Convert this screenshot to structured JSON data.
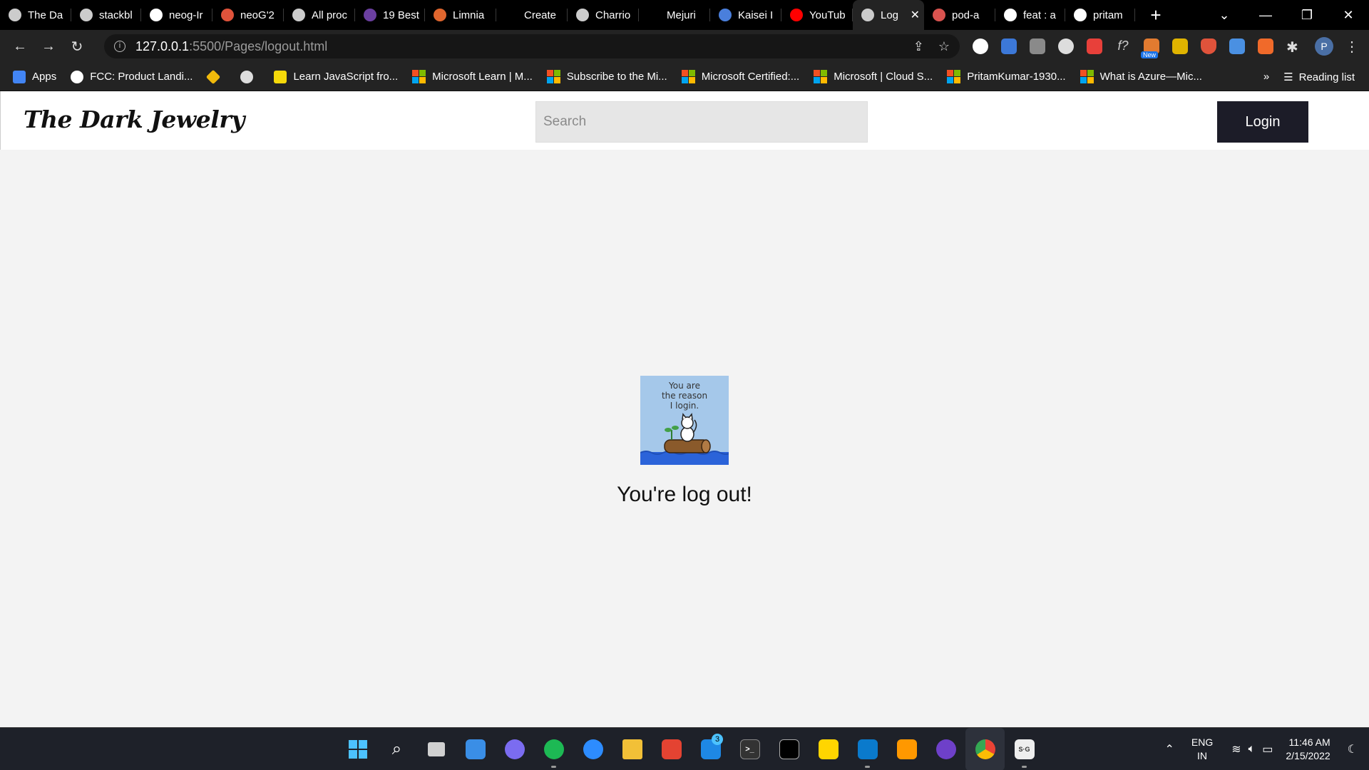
{
  "browser": {
    "tabs": [
      {
        "label": "The Da",
        "icon": "globe-icon",
        "color": "#cccccc"
      },
      {
        "label": "stackbl",
        "icon": "bolt-icon",
        "color": "#cccccc"
      },
      {
        "label": "neog-Ir",
        "icon": "neog-icon",
        "color": "#ffffff"
      },
      {
        "label": "neoG'2",
        "icon": "dots-icon",
        "color": "#e0533b"
      },
      {
        "label": "All proc",
        "icon": "globe-icon",
        "color": "#cccccc"
      },
      {
        "label": "19 Best",
        "icon": "colorlib-icon",
        "color": "#6b3fa0"
      },
      {
        "label": "Limnia",
        "icon": "circle-icon",
        "color": "#e0662e"
      },
      {
        "label": "Create",
        "icon": "blank-icon",
        "color": "#000000"
      },
      {
        "label": "Charrio",
        "icon": "globe-icon",
        "color": "#cccccc"
      },
      {
        "label": "Mejuri",
        "icon": "blank-icon",
        "color": "#000000"
      },
      {
        "label": "Kaisei I",
        "icon": "kaisei-icon",
        "color": "#4a7fdc"
      },
      {
        "label": "YouTub",
        "icon": "youtube-icon",
        "color": "#ff0000"
      },
      {
        "label": "Log",
        "icon": "globe-icon",
        "color": "#cccccc",
        "active": true
      },
      {
        "label": "pod-a",
        "icon": "pod-icon",
        "color": "#d9534f"
      },
      {
        "label": "feat : a",
        "icon": "github-icon",
        "color": "#ffffff"
      },
      {
        "label": "pritam",
        "icon": "github-icon",
        "color": "#ffffff"
      }
    ],
    "url": {
      "host": "127.0.0.1",
      "path": ":5500/Pages/logout.html"
    },
    "bookmarks": [
      {
        "label": "Apps",
        "icon": "apps-grid-icon"
      },
      {
        "label": "FCC: Product Landi...",
        "icon": "freecodecamp-icon"
      },
      {
        "label": "",
        "icon": "binance-icon"
      },
      {
        "label": "",
        "icon": "globe-icon"
      },
      {
        "label": "Learn JavaScript fro...",
        "icon": "scrimba-icon"
      },
      {
        "label": "Microsoft Learn | M...",
        "icon": "microsoft-icon"
      },
      {
        "label": "Subscribe to the Mi...",
        "icon": "microsoft-icon"
      },
      {
        "label": "Microsoft Certified:...",
        "icon": "microsoft-icon"
      },
      {
        "label": "Microsoft | Cloud S...",
        "icon": "microsoft-icon"
      },
      {
        "label": "PritamKumar-1930...",
        "icon": "microsoft-icon"
      },
      {
        "label": "What is Azure—Mic...",
        "icon": "microsoft-icon"
      }
    ],
    "bookmarks_more": "»",
    "reading_list": "Reading list",
    "new_badge": "New",
    "profile_initial": "P"
  },
  "site": {
    "brand": "The Dark Jewelry",
    "search_placeholder": "Search",
    "login_label": "Login",
    "image_caption": "You are\nthe reason\nI login.",
    "message": "You're log out!"
  },
  "taskbar": {
    "badge_count": "3",
    "lang_line1": "ENG",
    "lang_line2": "IN",
    "time": "11:46 AM",
    "date": "2/15/2022"
  },
  "colors": {
    "tab_bar": "#000000",
    "toolbar": "#232323",
    "page_bg": "#f3f3f3",
    "login_button": "#1c1c28",
    "search_bg": "#e6e6e6",
    "image_bg": "#a5c8ea",
    "taskbar": "#1e2129"
  }
}
